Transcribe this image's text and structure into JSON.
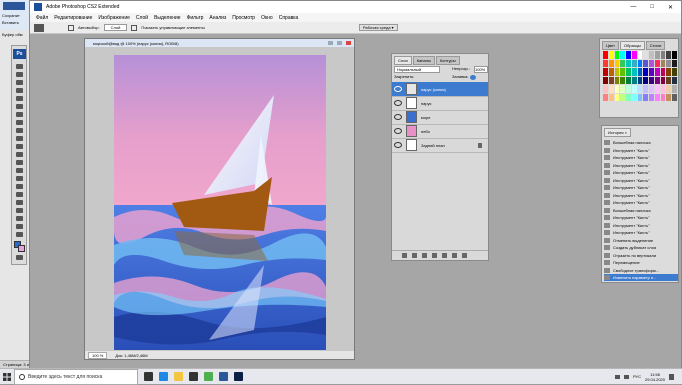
{
  "word": {
    "ribbon_labels": [
      "Сохранит",
      "Вставить",
      "Буфер обм"
    ],
    "status_left": "Страница: 3 из 5"
  },
  "app": {
    "title": "Adobe Photoshop CS2 Extended",
    "menu": [
      "Файл",
      "Редактирование",
      "Изображение",
      "Слой",
      "Выделение",
      "Фильтр",
      "Анализ",
      "Просмотр",
      "Окно",
      "Справка"
    ],
    "window_controls": [
      "—",
      "□",
      "✕"
    ]
  },
  "options_bar": {
    "autoselect_label": "Автовыбор:",
    "autoselect_value": "Слой",
    "show_controls_label": "Показать управляющие элементы",
    "workspace_button": "Рабочая среда ▾"
  },
  "document": {
    "title": "морской@вид @ 100% (парус (копия), RGB/8)",
    "zoom": "100 %",
    "doc_size": "Док: 1,46М/2,46М"
  },
  "layers_panel": {
    "tabs": [
      "Слои",
      "Каналы",
      "Контуры"
    ],
    "blend_mode": "Нормальный",
    "opacity_label": "Непрозр.:",
    "opacity_value": "100%",
    "fill_label": "Заливка:",
    "lock_label": "Закрепить:",
    "layers": [
      {
        "name": "парус (копия)",
        "selected": true,
        "thumb": "#e6e6e6"
      },
      {
        "name": "парус",
        "selected": false,
        "thumb": "#ffffff"
      },
      {
        "name": "море",
        "selected": false,
        "thumb": "#3a6fd0"
      },
      {
        "name": "небо",
        "selected": false,
        "thumb": "#e890c8"
      },
      {
        "name": "Задний план",
        "selected": false,
        "thumb": "#ffffff"
      }
    ]
  },
  "swatches_panel": {
    "tabs": [
      "Цвет",
      "Образцы",
      "Стили"
    ],
    "colors": [
      "#ff0000",
      "#ffff00",
      "#00ff00",
      "#00ffff",
      "#0000ff",
      "#ff00ff",
      "#ffffff",
      "#e0e0e0",
      "#c0c0c0",
      "#a0a0a0",
      "#808080",
      "#404040",
      "#000000",
      "#ff3b30",
      "#ff9500",
      "#ffcc00",
      "#34c759",
      "#00c7be",
      "#30b0c7",
      "#007aff",
      "#5856d6",
      "#af52de",
      "#ff2d55",
      "#a2845e",
      "#8e8e93",
      "#1c1c1e",
      "#c00000",
      "#c06000",
      "#c0c000",
      "#60c000",
      "#00c060",
      "#00c0c0",
      "#0060c0",
      "#0000c0",
      "#6000c0",
      "#c000c0",
      "#c00060",
      "#804000",
      "#404000",
      "#800000",
      "#804020",
      "#808000",
      "#408000",
      "#008040",
      "#008080",
      "#004080",
      "#000080",
      "#400080",
      "#800080",
      "#800040",
      "#604020",
      "#203040",
      "#ffc0c0",
      "#ffe0c0",
      "#ffffc0",
      "#e0ffc0",
      "#c0ffe0",
      "#c0ffff",
      "#c0e0ff",
      "#c0c0ff",
      "#e0c0ff",
      "#ffc0ff",
      "#ffc0e0",
      "#e8d0b0",
      "#b0b0b0",
      "#ff8080",
      "#ffc080",
      "#ffff80",
      "#c0ff80",
      "#80ffc0",
      "#80ffff",
      "#80c0ff",
      "#8080ff",
      "#c080ff",
      "#ff80ff",
      "#ff80c0",
      "#c09060",
      "#606060"
    ]
  },
  "history_panel": {
    "tabs": [
      "История ×"
    ],
    "items": [
      {
        "label": "Волшебная палочка",
        "selected": false
      },
      {
        "label": "Инструмент \"Кисть\"",
        "selected": false
      },
      {
        "label": "Инструмент \"Кисть\"",
        "selected": false
      },
      {
        "label": "Инструмент \"Кисть\"",
        "selected": false
      },
      {
        "label": "Инструмент \"Кисть\"",
        "selected": false
      },
      {
        "label": "Инструмент \"Кисть\"",
        "selected": false
      },
      {
        "label": "Инструмент \"Кисть\"",
        "selected": false
      },
      {
        "label": "Инструмент \"Кисть\"",
        "selected": false
      },
      {
        "label": "Инструмент \"Кисть\"",
        "selected": false
      },
      {
        "label": "Волшебная палочка",
        "selected": false
      },
      {
        "label": "Инструмент \"Кисть\"",
        "selected": false
      },
      {
        "label": "Инструмент \"Кисть\"",
        "selected": false
      },
      {
        "label": "Инструмент \"Кисть\"",
        "selected": false
      },
      {
        "label": "Отменить выделение",
        "selected": false
      },
      {
        "label": "Создать дубликат слоя",
        "selected": false
      },
      {
        "label": "Отразить по вертикали",
        "selected": false
      },
      {
        "label": "Перемещение",
        "selected": false
      },
      {
        "label": "Свободное трансформ...",
        "selected": false
      },
      {
        "label": "Изменить параметр н...",
        "selected": true
      }
    ]
  },
  "taskbar": {
    "search_placeholder": "Введите здесь текст для поиска",
    "lang": "РУС",
    "time": "11:58",
    "date": "29.04.2020",
    "app_icons": [
      {
        "name": "task-view-icon",
        "color": "#333333"
      },
      {
        "name": "edge-icon",
        "color": "#1e88e5"
      },
      {
        "name": "explorer-icon",
        "color": "#f4c542"
      },
      {
        "name": "store-icon",
        "color": "#333333"
      },
      {
        "name": "chrome-icon",
        "color": "#4caf50"
      },
      {
        "name": "word-icon",
        "color": "#2b579a"
      },
      {
        "name": "photoshop-icon",
        "color": "#0b1f45"
      }
    ]
  }
}
